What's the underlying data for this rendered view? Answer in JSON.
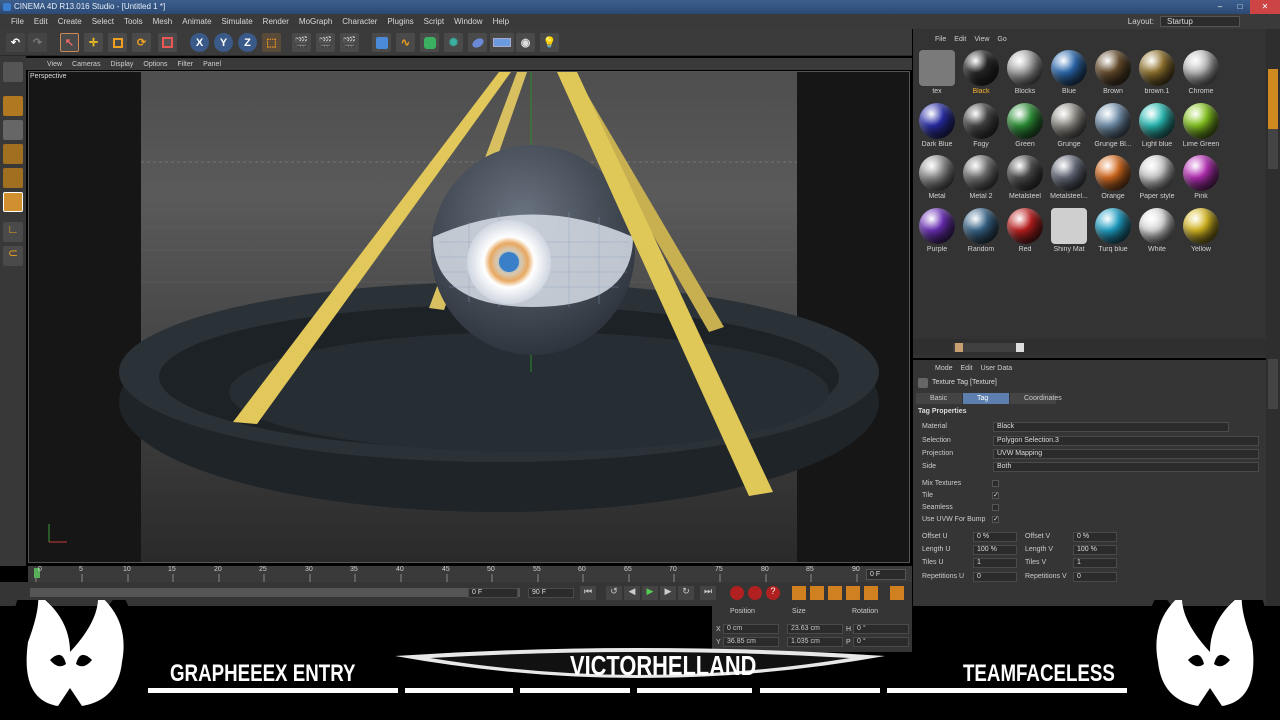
{
  "window": {
    "title": "CINEMA 4D R13.016 Studio - [Untitled 1 *]"
  },
  "menubar": {
    "items": [
      "File",
      "Edit",
      "Create",
      "Select",
      "Tools",
      "Mesh",
      "Animate",
      "Simulate",
      "Render",
      "MoGraph",
      "Character",
      "Plugins",
      "Script",
      "Window",
      "Help"
    ],
    "layout_label": "Layout:",
    "layout_value": "Startup"
  },
  "toolbar": {
    "axis_x": "X",
    "axis_y": "Y",
    "axis_z": "Z"
  },
  "viewport": {
    "menu": [
      "View",
      "Cameras",
      "Display",
      "Options",
      "Filter",
      "Panel"
    ],
    "label": "Perspective"
  },
  "timeline": {
    "ticks": [
      "0",
      "5",
      "10",
      "15",
      "20",
      "25",
      "30",
      "35",
      "40",
      "45",
      "50",
      "55",
      "60",
      "65",
      "70",
      "75",
      "80",
      "85",
      "90"
    ],
    "current_frame": "0 F",
    "start_field": "0 F",
    "end_field": "90 F"
  },
  "material_manager": {
    "menu": [
      "File",
      "Edit",
      "View",
      "Go"
    ],
    "materials": [
      {
        "name": "tex",
        "color": "#7a7a7a",
        "icon": "folder-icon"
      },
      {
        "name": "Black",
        "color": "#2a2a2a",
        "selected": true
      },
      {
        "name": "Blocks",
        "color": "#b0b0b0"
      },
      {
        "name": "Blue",
        "color": "#2e6fb8"
      },
      {
        "name": "Brown",
        "color": "#6a4f2c"
      },
      {
        "name": "brown.1",
        "color": "#9a7a30"
      },
      {
        "name": "Chrome",
        "color": "#c8c8c8"
      },
      {
        "name": "Dark Blue",
        "color": "#2a2fb0"
      },
      {
        "name": "Fogy",
        "color": "#4a4a4a"
      },
      {
        "name": "Green",
        "color": "#2f9a3a"
      },
      {
        "name": "Grunge",
        "color": "#9a9890"
      },
      {
        "name": "Grunge Bl...",
        "color": "#7a9ab8"
      },
      {
        "name": "Light blue",
        "color": "#2cc8c0"
      },
      {
        "name": "Lime Green",
        "color": "#8cd020"
      },
      {
        "name": "Metal",
        "color": "#9a9a9a"
      },
      {
        "name": "Metal 2",
        "color": "#7a7a7a"
      },
      {
        "name": "Metalsteel",
        "color": "#505050"
      },
      {
        "name": "Metalsteel...",
        "color": "#6a7080"
      },
      {
        "name": "Orange",
        "color": "#e07020"
      },
      {
        "name": "Paper style",
        "color": "#d8d8d8"
      },
      {
        "name": "Pink",
        "color": "#c030c0"
      },
      {
        "name": "Purple",
        "color": "#7030c0"
      },
      {
        "name": "Random",
        "color": "#3a6a90"
      },
      {
        "name": "Red",
        "color": "#c82020"
      },
      {
        "name": "Shiny Mat",
        "color": "#cfcfcf",
        "icon": "bottle-icon"
      },
      {
        "name": "Turq blue",
        "color": "#20a8d0"
      },
      {
        "name": "White",
        "color": "#e8e8e8"
      },
      {
        "name": "Yellow",
        "color": "#e0c020"
      }
    ]
  },
  "attributes": {
    "menu": [
      "Mode",
      "Edit",
      "User Data"
    ],
    "title": "Texture Tag [Texture]",
    "tabs": [
      "Basic",
      "Tag",
      "Coordinates"
    ],
    "active_tab": "Tag",
    "section": "Tag Properties",
    "material_label": "Material",
    "material_value": "Black",
    "selection_label": "Selection",
    "selection_value": "Polygon Selection.3",
    "projection_label": "Projection",
    "projection_value": "UVW Mapping",
    "side_label": "Side",
    "side_value": "Both",
    "mix_textures_label": "Mix Textures",
    "mix_textures": "",
    "tile_label": "Tile",
    "tile": "✓",
    "seamless_label": "Seamless",
    "seamless": "",
    "use_uvw_label": "Use UVW For Bump",
    "use_uvw": "✓",
    "offset_u_label": "Offset U",
    "offset_u": "0 %",
    "offset_v_label": "Offset V",
    "offset_v": "0 %",
    "length_u_label": "Length U",
    "length_u": "100 %",
    "length_v_label": "Length V",
    "length_v": "100 %",
    "tiles_u_label": "Tiles U",
    "tiles_u": "1",
    "tiles_v_label": "Tiles V",
    "tiles_v": "1",
    "rep_u_label": "Repetitions U",
    "rep_u": "0",
    "rep_v_label": "Repetitions V",
    "rep_v": "0"
  },
  "coordinates": {
    "headers": [
      "Position",
      "Size",
      "Rotation"
    ],
    "x_label": "X",
    "x_pos": "0 cm",
    "x_size": "23.63 cm",
    "h_label": "H",
    "h_rot": "0 °",
    "y_label": "Y",
    "y_pos": "36.85 cm",
    "y_size": "1.035 cm",
    "p_label": "P",
    "p_rot": "0 °"
  },
  "overlay": {
    "left_text": "GRAPHEEEX ENTRY",
    "center_text": "VICTORHELLAND",
    "right_text": "TEAMFACELESS"
  }
}
